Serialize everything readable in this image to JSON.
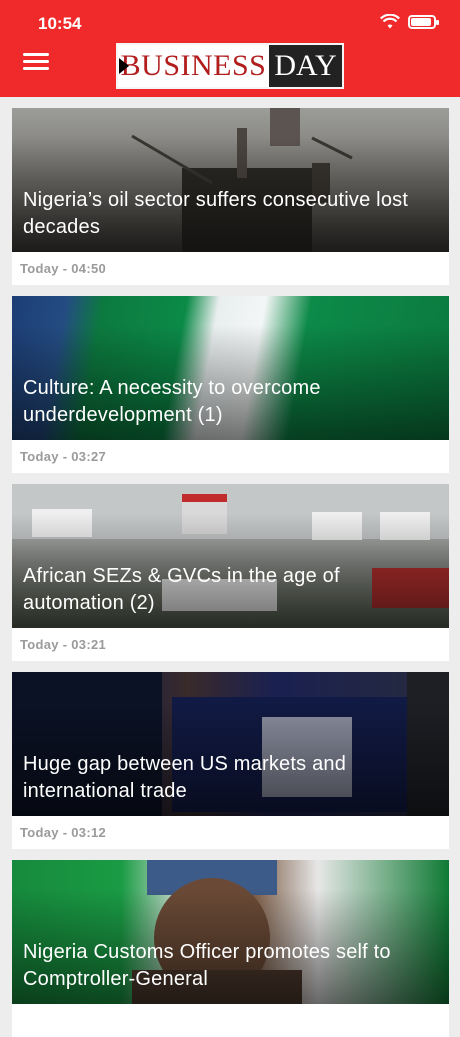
{
  "status_bar": {
    "time": "10:54"
  },
  "header": {
    "logo_left": "BUSINESS",
    "logo_right": "DAY"
  },
  "articles": [
    {
      "title": "Nigeria’s oil sector suffers consecutive lost decades",
      "time": "Today - 04:50"
    },
    {
      "title": "Culture: A necessity to overcome underdevelopment (1)",
      "time": "Today - 03:27"
    },
    {
      "title": "African SEZs & GVCs in the age of automation (2)",
      "time": "Today - 03:21"
    },
    {
      "title": "Huge gap between US markets and international trade",
      "time": "Today - 03:12"
    },
    {
      "title": "Nigeria Customs Officer promotes self to Comptroller-General",
      "time": ""
    }
  ]
}
